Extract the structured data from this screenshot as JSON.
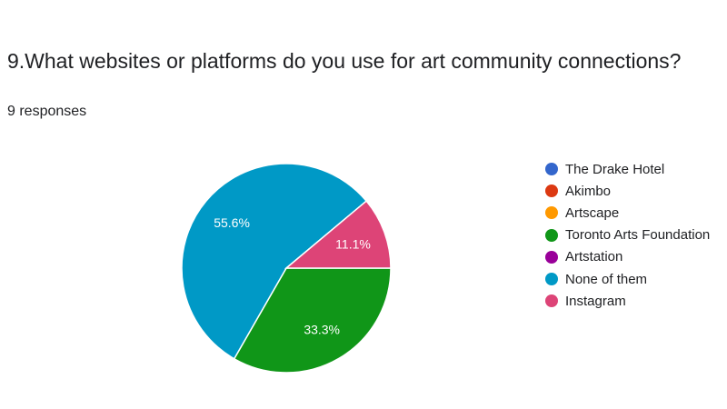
{
  "question": {
    "title": "9.What websites or platforms do you use for art community connections?",
    "responses": "9 responses"
  },
  "chart_data": {
    "type": "pie",
    "title": "9.What websites or platforms do you use for art community connections?",
    "legend_position": "right",
    "series": [
      {
        "name": "The Drake Hotel",
        "value": 0,
        "color": "#3366cc",
        "label": ""
      },
      {
        "name": "Akimbo",
        "value": 0,
        "color": "#dc3912",
        "label": ""
      },
      {
        "name": "Artscape",
        "value": 0,
        "color": "#ff9900",
        "label": ""
      },
      {
        "name": "Toronto Arts Foundation",
        "value": 33.3,
        "color": "#109618",
        "label": "33.3%"
      },
      {
        "name": "Artstation",
        "value": 0,
        "color": "#990099",
        "label": ""
      },
      {
        "name": "None of them",
        "value": 55.6,
        "color": "#0099c6",
        "label": "55.6%"
      },
      {
        "name": "Instagram",
        "value": 11.1,
        "color": "#dd4477",
        "label": "11.1%"
      }
    ]
  }
}
